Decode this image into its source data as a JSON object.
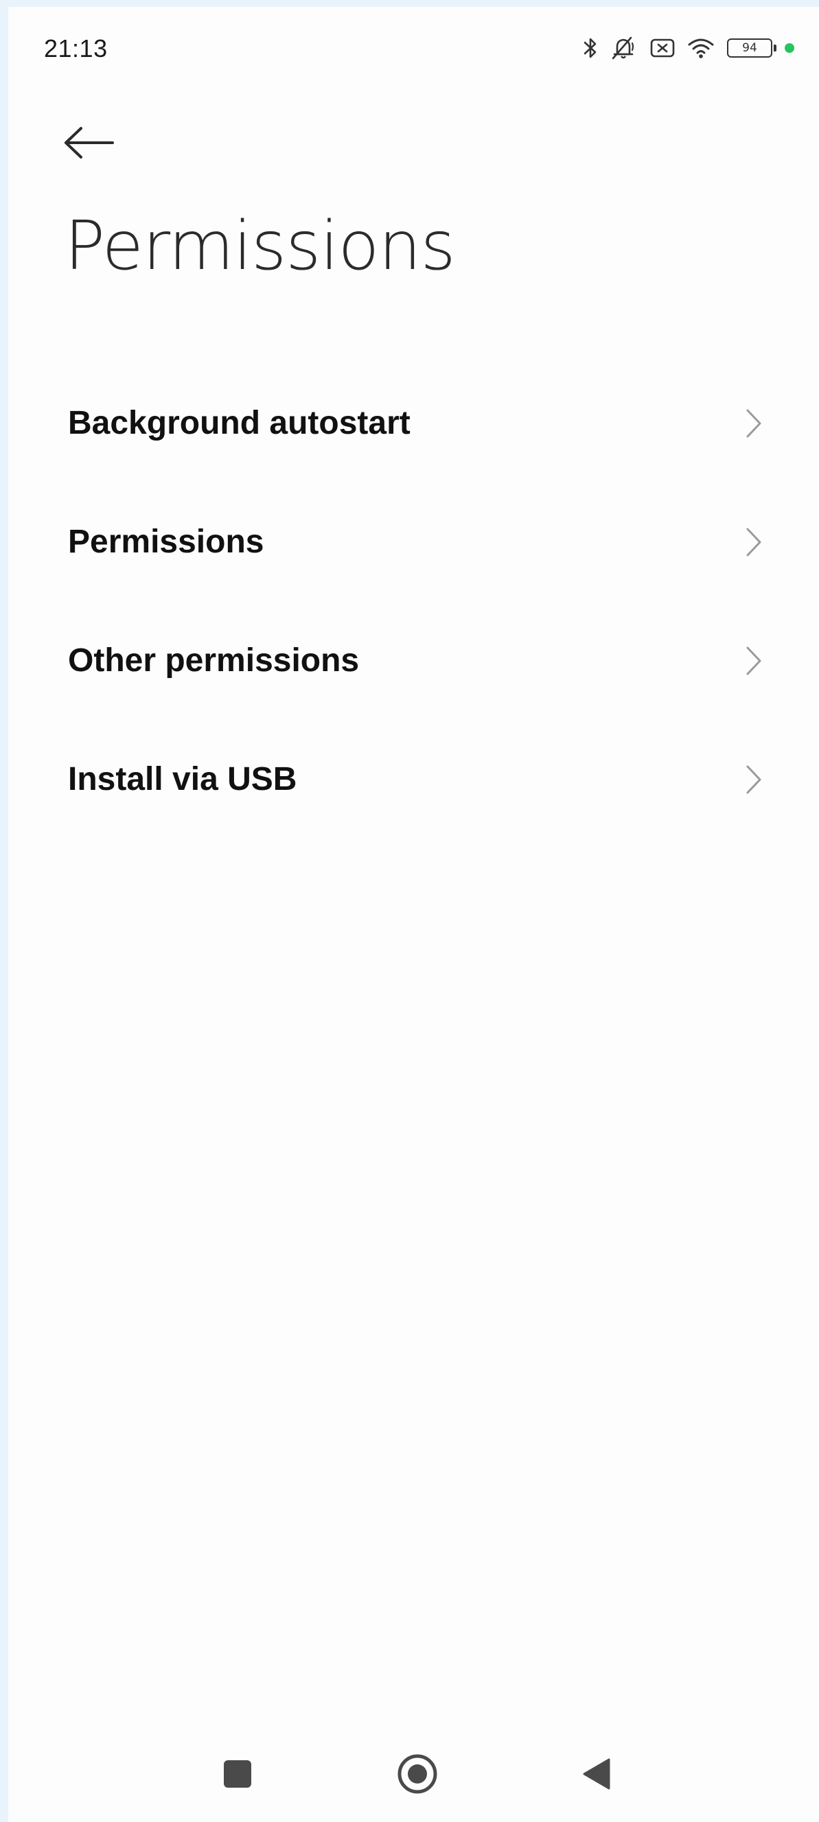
{
  "status_bar": {
    "time": "21:13",
    "battery_level": "94",
    "icons": [
      "bluetooth-icon",
      "muted-bell-icon",
      "sim-x-icon",
      "wifi-icon",
      "battery-icon",
      "green-dot-indicator"
    ],
    "indicator_color": "#22c55e"
  },
  "header": {
    "back_icon": "arrow-left-icon",
    "title": "Permissions"
  },
  "menu": {
    "items": [
      {
        "label": "Background autostart",
        "icon": "chevron-right-icon"
      },
      {
        "label": "Permissions",
        "icon": "chevron-right-icon"
      },
      {
        "label": "Other permissions",
        "icon": "chevron-right-icon"
      },
      {
        "label": "Install via USB",
        "icon": "chevron-right-icon"
      }
    ]
  },
  "navigation_bar": {
    "buttons": [
      "recents-square-icon",
      "home-circle-icon",
      "back-triangle-icon"
    ]
  }
}
